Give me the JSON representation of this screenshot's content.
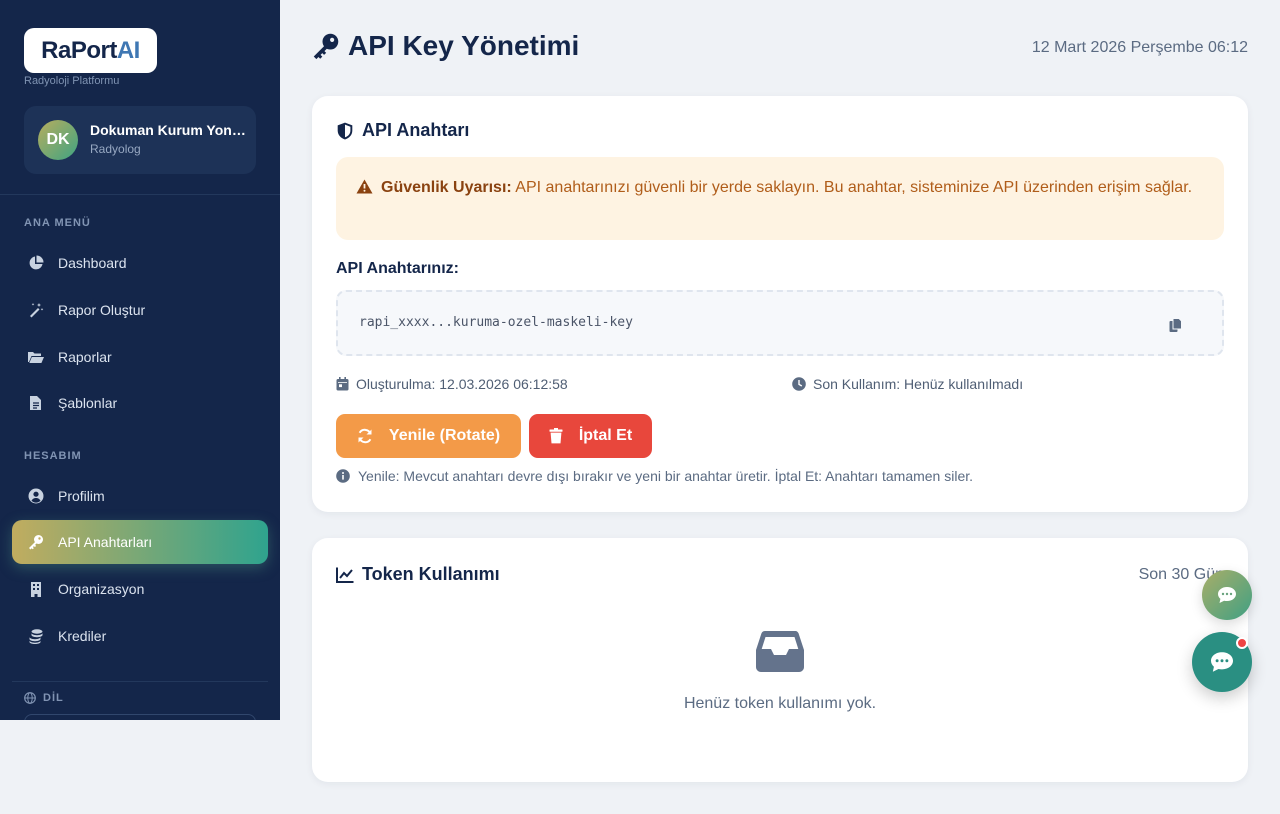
{
  "brand": {
    "name_main": "RaPort",
    "name_accent": "AI",
    "subtitle": "Radyoloji Platformu"
  },
  "user": {
    "initials": "DK",
    "name": "Dokuman Kurum Yonetici",
    "role": "Radyolog"
  },
  "sidebar": {
    "main_section": "ANA MENÜ",
    "main_items": [
      {
        "label": "Dashboard",
        "icon": "chart-pie-icon"
      },
      {
        "label": "Rapor Oluştur",
        "icon": "magic-wand-icon"
      },
      {
        "label": "Raporlar",
        "icon": "folder-open-icon"
      },
      {
        "label": "Şablonlar",
        "icon": "file-alt-icon"
      }
    ],
    "account_section": "HESABIM",
    "account_items": [
      {
        "label": "Profilim",
        "icon": "user-circle-icon"
      },
      {
        "label": "API Anahtarları",
        "icon": "key-icon",
        "active": true
      },
      {
        "label": "Organizasyon",
        "icon": "building-icon"
      },
      {
        "label": "Krediler",
        "icon": "coins-icon"
      }
    ],
    "language_label": "DİL"
  },
  "header": {
    "title": "API Key Yönetimi",
    "date": "12 Mart 2026 Perşembe 06:12"
  },
  "api_card": {
    "title": "API Anahtarı",
    "alert_bold": "Güvenlik Uyarısı:",
    "alert_text": "API anahtarınızı güvenli bir yerde saklayın. Bu anahtar, sisteminize API üzerinden erişim sağlar.",
    "key_label": "API Anahtarınız:",
    "key_value": "rapi_xxxx...kuruma-ozel-maskeli-key",
    "created": "Oluşturulma: 12.03.2026 06:12:58",
    "last_used": "Son Kullanım: Henüz kullanılmadı",
    "rotate_label": "Yenile (Rotate)",
    "cancel_label": "İptal Et",
    "hint": "Yenile: Mevcut anahtarı devre dışı bırakır ve yeni bir anahtar üretir. İptal Et: Anahtarı tamamen siler."
  },
  "token_card": {
    "title": "Token Kullanımı",
    "period": "Son 30 Gün",
    "empty_text": "Henüz token kullanımı yok."
  },
  "colors": {
    "sidebar_bg": "#14264a",
    "accent_orange": "#f39a48",
    "danger": "#e8473c",
    "teal": "#2a8f82"
  }
}
